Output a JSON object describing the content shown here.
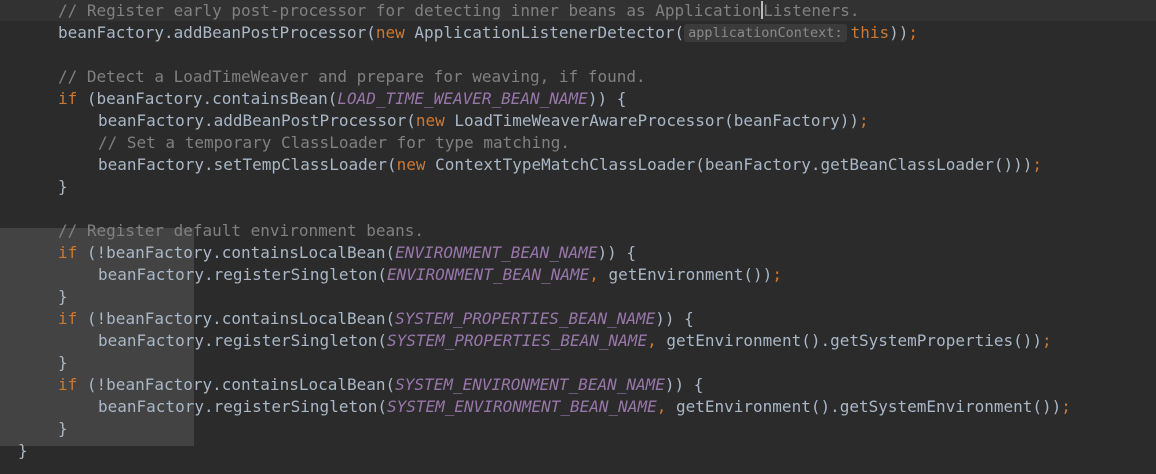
{
  "editor": {
    "lines": [
      {
        "tokens": [
          {
            "t": "// Register early post-processor for detecting inner beans as Application",
            "c": "comment"
          },
          {
            "t": "Listeners.",
            "c": "comment"
          }
        ]
      },
      {
        "tokens": [
          {
            "t": "beanFactory.addBeanPostProcessor(",
            "c": "plain"
          },
          {
            "t": "new ",
            "c": "kw"
          },
          {
            "t": "ApplicationListenerDetector(",
            "c": "plain"
          },
          {
            "t": "applicationContext:",
            "c": "hint"
          },
          {
            "t": "this",
            "c": "kw"
          },
          {
            "t": "))",
            "c": "plain"
          },
          {
            "t": ";",
            "c": "kw"
          }
        ]
      },
      {
        "tokens": []
      },
      {
        "tokens": [
          {
            "t": "// Detect a LoadTimeWeaver and prepare for weaving, if found.",
            "c": "comment"
          }
        ]
      },
      {
        "tokens": [
          {
            "t": "if ",
            "c": "kw"
          },
          {
            "t": "(beanFactory.containsBean(",
            "c": "plain"
          },
          {
            "t": "LOAD_TIME_WEAVER_BEAN_NAME",
            "c": "const"
          },
          {
            "t": ")) {",
            "c": "plain"
          }
        ]
      },
      {
        "tokens": [
          {
            "t": "beanFactory.addBeanPostProcessor(",
            "c": "plain"
          },
          {
            "t": "new ",
            "c": "kw"
          },
          {
            "t": "LoadTimeWeaverAwareProcessor(beanFactory))",
            "c": "plain"
          },
          {
            "t": ";",
            "c": "kw"
          }
        ]
      },
      {
        "tokens": [
          {
            "t": "// Set a temporary ClassLoader for type matching.",
            "c": "comment"
          }
        ]
      },
      {
        "tokens": [
          {
            "t": "beanFactory.setTempClassLoader(",
            "c": "plain"
          },
          {
            "t": "new ",
            "c": "kw"
          },
          {
            "t": "ContextTypeMatchClassLoader(beanFactory.getBeanClassLoader()))",
            "c": "plain"
          },
          {
            "t": ";",
            "c": "kw"
          }
        ]
      },
      {
        "tokens": [
          {
            "t": "}",
            "c": "plain"
          }
        ]
      },
      {
        "tokens": []
      },
      {
        "tokens": [
          {
            "t": "// Register default environment beans.",
            "c": "comment"
          }
        ]
      },
      {
        "tokens": [
          {
            "t": "if ",
            "c": "kw"
          },
          {
            "t": "(!beanFactory.containsLocalBean(",
            "c": "plain"
          },
          {
            "t": "ENVIRONMENT_BEAN_NAME",
            "c": "const"
          },
          {
            "t": ")) {",
            "c": "plain"
          }
        ]
      },
      {
        "tokens": [
          {
            "t": "beanFactory.registerSingleton(",
            "c": "plain"
          },
          {
            "t": "ENVIRONMENT_BEAN_NAME",
            "c": "const"
          },
          {
            "t": ", ",
            "c": "kw"
          },
          {
            "t": "getEnvironment())",
            "c": "plain"
          },
          {
            "t": ";",
            "c": "kw"
          }
        ]
      },
      {
        "tokens": [
          {
            "t": "}",
            "c": "plain"
          }
        ]
      },
      {
        "tokens": [
          {
            "t": "if ",
            "c": "kw"
          },
          {
            "t": "(!beanFactory.containsLocalBean(",
            "c": "plain"
          },
          {
            "t": "SYSTEM_PROPERTIES_BEAN_NAME",
            "c": "const"
          },
          {
            "t": ")) {",
            "c": "plain"
          }
        ]
      },
      {
        "tokens": [
          {
            "t": "beanFactory.registerSingleton(",
            "c": "plain"
          },
          {
            "t": "SYSTEM_PROPERTIES_BEAN_NAME",
            "c": "const"
          },
          {
            "t": ", ",
            "c": "kw"
          },
          {
            "t": "getEnvironment().getSystemProperties())",
            "c": "plain"
          },
          {
            "t": ";",
            "c": "kw"
          }
        ]
      },
      {
        "tokens": [
          {
            "t": "}",
            "c": "plain"
          }
        ]
      },
      {
        "tokens": [
          {
            "t": "if ",
            "c": "kw"
          },
          {
            "t": "(!beanFactory.containsLocalBean(",
            "c": "plain"
          },
          {
            "t": "SYSTEM_ENVIRONMENT_BEAN_NAME",
            "c": "const"
          },
          {
            "t": ")) {",
            "c": "plain"
          }
        ]
      },
      {
        "tokens": [
          {
            "t": "beanFactory.registerSingleton(",
            "c": "plain"
          },
          {
            "t": "SYSTEM_ENVIRONMENT_BEAN_NAME",
            "c": "const"
          },
          {
            "t": ", ",
            "c": "kw"
          },
          {
            "t": "getEnvironment().getSystemEnvironment())",
            "c": "plain"
          },
          {
            "t": ";",
            "c": "kw"
          }
        ]
      },
      {
        "tokens": [
          {
            "t": "}",
            "c": "plain"
          }
        ]
      },
      {
        "tokens": [
          {
            "t": "}",
            "c": "plain"
          }
        ]
      }
    ]
  },
  "colors": {
    "background": "#2b2b2b",
    "current_line": "#323232",
    "block_highlight": "#434343",
    "plain": "#a9b7c6",
    "comment": "#808080",
    "keyword": "#cc7832",
    "constant": "#9876aa",
    "inlay_hint": "#8a8a8a"
  }
}
